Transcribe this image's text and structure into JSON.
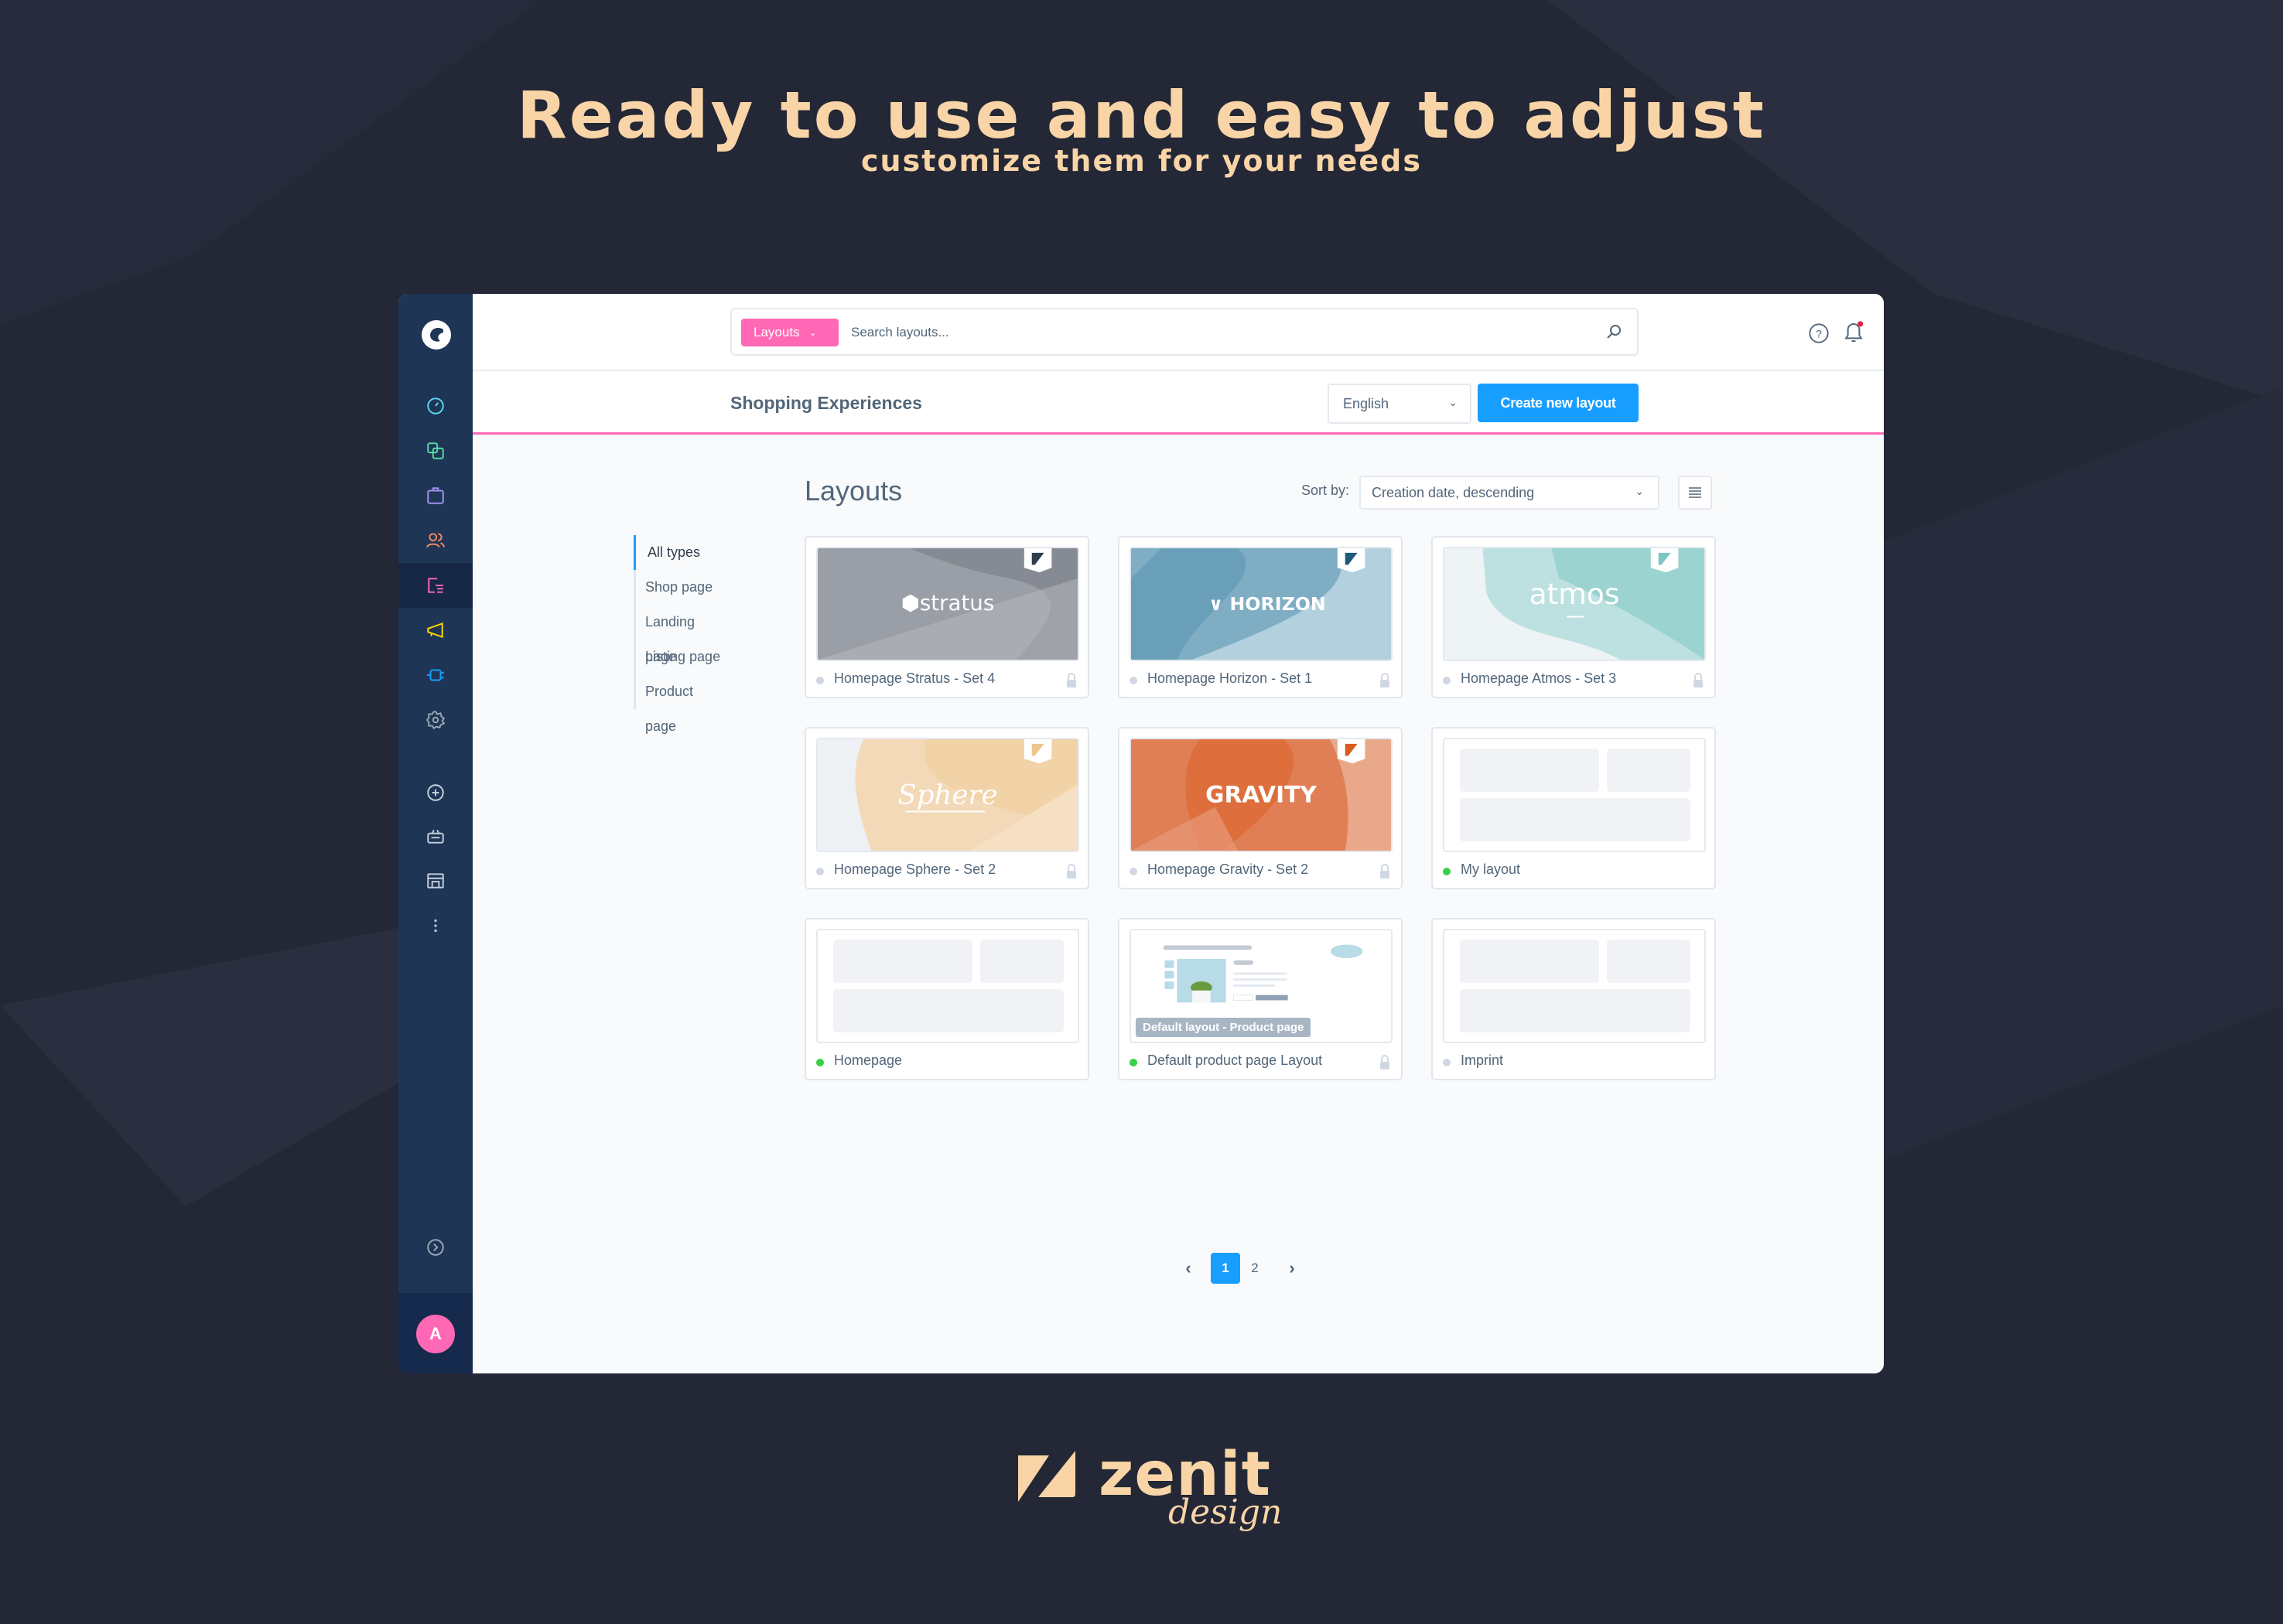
{
  "hero": {
    "title": "Ready to use and easy to adjust",
    "subtitle": "customize them for your needs"
  },
  "colors": {
    "background": "#232736",
    "accent_peach": "#f8d4a6",
    "sidebar": "#1f3556",
    "brand_pink": "#ff68b4",
    "primary_blue": "#189eff",
    "status_active": "#37d046",
    "status_inactive": "#cfd8e2"
  },
  "sidebar": {
    "logo": "shopware-logo",
    "items": [
      {
        "icon": "dashboard-icon",
        "color": "#57d9f0",
        "active": false
      },
      {
        "icon": "catalogues-icon",
        "color": "#57d9a3",
        "active": false
      },
      {
        "icon": "orders-icon",
        "color": "#a092f0",
        "active": false
      },
      {
        "icon": "customers-icon",
        "color": "#f88962",
        "active": false
      },
      {
        "icon": "content-icon",
        "color": "#ff68b4",
        "active": true
      },
      {
        "icon": "marketing-icon",
        "color": "#ffd700",
        "active": false
      },
      {
        "icon": "extensions-icon",
        "color": "#189eff",
        "active": false
      },
      {
        "icon": "settings-icon",
        "color": "#9aa8b5",
        "active": false
      }
    ],
    "secondary": [
      {
        "icon": "add-circle-icon"
      },
      {
        "icon": "shopping-basket-icon"
      },
      {
        "icon": "storefront-icon"
      },
      {
        "icon": "more-vertical-icon"
      }
    ],
    "collapse_icon": "chevron-right-circle-icon",
    "user_initial": "A"
  },
  "topbar": {
    "search_type": "Layouts",
    "search_placeholder": "Search layouts...",
    "search_icon": "search-icon",
    "help_icon": "help-icon",
    "notification_icon": "bell-icon",
    "has_notification": true
  },
  "subheader": {
    "title": "Shopping Experiences",
    "language": "English",
    "create_button": "Create new layout"
  },
  "content": {
    "title": "Layouts",
    "sort_label": "Sort by:",
    "sort_value": "Creation date, descending",
    "view_toggle_icon": "list-view-icon",
    "types": [
      {
        "label": "All types",
        "active": true
      },
      {
        "label": "Shop page",
        "active": false
      },
      {
        "label": "Landing page",
        "active": false
      },
      {
        "label": "Listing page",
        "active": false
      },
      {
        "label": "Product page",
        "active": false
      }
    ],
    "layouts": [
      {
        "name": "Homepage Stratus - Set 4",
        "theme": "stratus",
        "brand": "stratus",
        "active": false,
        "locked": true
      },
      {
        "name": "Homepage Horizon - Set 1",
        "theme": "horizon",
        "brand": "HORIZON",
        "active": false,
        "locked": true
      },
      {
        "name": "Homepage Atmos - Set 3",
        "theme": "atmos",
        "brand": "atmos",
        "active": false,
        "locked": true
      },
      {
        "name": "Homepage Sphere - Set 2",
        "theme": "sphere",
        "brand": "Sphere",
        "active": false,
        "locked": true
      },
      {
        "name": "Homepage Gravity - Set 2",
        "theme": "gravity",
        "brand": "GRAVITY",
        "active": false,
        "locked": true
      },
      {
        "name": "My layout",
        "theme": "blank",
        "active": true,
        "locked": false
      },
      {
        "name": "Homepage",
        "theme": "blank",
        "active": true,
        "locked": false
      },
      {
        "name": "Default product page Layout",
        "theme": "product",
        "badge": "Default layout - Product page",
        "active": true,
        "locked": true
      },
      {
        "name": "Imprint",
        "theme": "blank",
        "active": false,
        "locked": false
      }
    ],
    "pagination": {
      "pages": [
        "1",
        "2"
      ],
      "current": "1",
      "prev_icon": "chevron-left-icon",
      "next_icon": "chevron-right-icon"
    }
  },
  "footer": {
    "brand": "zenit",
    "brand_sub": "design"
  }
}
